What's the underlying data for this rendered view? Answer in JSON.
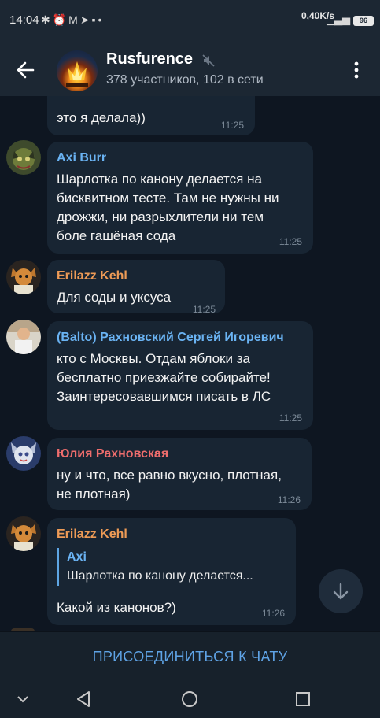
{
  "status_bar": {
    "time": "14:04",
    "left_icons": [
      "bluetooth-icon",
      "alarm-icon",
      "gmail-icon",
      "telegram-icon",
      "signal-icon"
    ],
    "network_speed": "0,40K/s",
    "battery": "96"
  },
  "header": {
    "title": "Rusfurence",
    "subtitle": "378 участников, 102 в сети",
    "muted": true
  },
  "messages": [
    {
      "text": "это я делала))",
      "time": "11:25"
    },
    {
      "sender": "Axi Burr",
      "sender_color": "#6ab3f3",
      "text": "Шарлотка по канону делается на\nбисквитном тесте. Там не нужны ни\nдрожжи, ни разрыхлители ни тем\nболе гашёная сода",
      "time": "11:25"
    },
    {
      "sender": "Erilazz Kehl",
      "sender_color": "#ee9b56",
      "text": "Для соды и уксуса",
      "time": "11:25"
    },
    {
      "sender": "(Balto) Рахновский Сергей Игоревич",
      "sender_color": "#6ab3f3",
      "text": "кто с Москвы. Отдам яблоки за\nбесплатно приезжайте собирайте!\nЗаинтересовавшимся писать в ЛС",
      "time": "11:25"
    },
    {
      "sender": "Юлия Рахновская",
      "sender_color": "#ee6d6d",
      "text": "ну и что, все равно вкусно, плотная,\nне плотная)",
      "time": "11:26"
    },
    {
      "sender": "Erilazz Kehl",
      "sender_color": "#ee9b56",
      "reply": {
        "name": "Axi",
        "text": "Шарлотка по канону делается..."
      },
      "text": "Какой из канонов?)",
      "time": "11:26"
    }
  ],
  "join_button": "ПРИСОЕДИНИТЬСЯ К ЧАТУ",
  "colors": {
    "background": "#0e1621",
    "bubble": "#182533",
    "header": "#1c2733",
    "accent": "#5fa3e5"
  }
}
